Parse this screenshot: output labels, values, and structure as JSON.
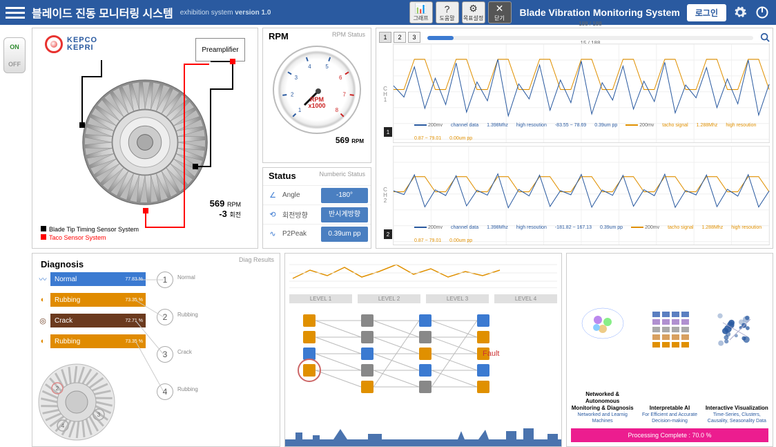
{
  "header": {
    "app_title_kr": "블레이드 진동 모니터링 시스템",
    "sub_label": "exhibition system",
    "version_label": "version 1.0",
    "app_title_en": "Blade Vibration Monitoring System",
    "login_btn": "로그인",
    "icon_btns": [
      {
        "name": "chart-icon",
        "label": "그래프"
      },
      {
        "name": "question-icon",
        "label": "도움말"
      },
      {
        "name": "gear-icon",
        "label": "목표설정"
      },
      {
        "name": "close-icon",
        "label": "닫기"
      }
    ]
  },
  "toggle": {
    "on": "ON",
    "off": "OFF"
  },
  "turbine": {
    "logo1": "KEPCO",
    "logo2": "KEPRI",
    "preamp": "Preamplifier",
    "rpm": "569",
    "rpm_unit": "RPM",
    "rot": "-3",
    "rot_unit": "회전",
    "legend_black": "Blade Tip Timing Sensor System",
    "legend_red": "Taco Sensor System"
  },
  "rpm_panel": {
    "title": "RPM",
    "sub": "RPM Status",
    "gauge_label": "RPM\nx1000",
    "ticks": [
      "1",
      "2",
      "3",
      "4",
      "5",
      "6",
      "7",
      "8"
    ],
    "value": "569",
    "unit": "RPM"
  },
  "status_panel": {
    "title": "Status",
    "sub": "Numberic Status",
    "rows": [
      {
        "icon": "angle-icon",
        "label": "Angle",
        "value": "-180°"
      },
      {
        "icon": "rotation-icon",
        "label": "회전방향",
        "value": "반시계방향"
      },
      {
        "icon": "peak-icon",
        "label": "P2Peak",
        "value": "0.39um pp"
      }
    ]
  },
  "charts": {
    "pages": [
      "1",
      "2",
      "3"
    ],
    "progress_top": "188 / 188",
    "progress_bottom": "15 / 188",
    "progress_pct": 8,
    "ch": [
      {
        "label": "CH1",
        "tag": "1",
        "legend": [
          {
            "color": "#2a5aa0",
            "vol": "200mv",
            "src": "channel data",
            "freq": "1.398Mhz",
            "res": "high resoution",
            "a": "-83.55",
            "b": "78.69",
            "c": "0.39um pp"
          },
          {
            "color": "#e09000",
            "vol": "200mv",
            "src": "tacho signal",
            "freq": "1.288Mhz",
            "res": "high resoution",
            "a": "0.87",
            "b": "79.01",
            "c": "0.00um pp"
          }
        ]
      },
      {
        "label": "CH2",
        "tag": "2",
        "legend": [
          {
            "color": "#2a5aa0",
            "vol": "200mv",
            "src": "channel data",
            "freq": "1.398Mhz",
            "res": "high resoution",
            "a": "-181.82",
            "b": "167.13",
            "c": "0.39um pp"
          },
          {
            "color": "#e09000",
            "vol": "200mv",
            "src": "tacho signal",
            "freq": "1.288Mhz",
            "res": "high resoution",
            "a": "0.87",
            "b": "79.01",
            "c": "0.00um pp"
          }
        ]
      }
    ]
  },
  "diagnosis": {
    "title": "Diagnosis",
    "sub": "Diag Results",
    "items": [
      {
        "label": "Normal",
        "color": "#3b7ad1",
        "pct": "77.83 %"
      },
      {
        "label": "Rubbing",
        "color": "#e08b00",
        "pct": "73.35 %"
      },
      {
        "label": "Crack",
        "color": "#6b3a1e",
        "pct": "72.71 %"
      },
      {
        "label": "Rubbing",
        "color": "#e08b00",
        "pct": "73.35 %"
      }
    ],
    "nums": [
      {
        "n": "1",
        "lbl": "Normal"
      },
      {
        "n": "2",
        "lbl": "Rubbing"
      },
      {
        "n": "3",
        "lbl": "Crack"
      },
      {
        "n": "4",
        "lbl": "Rubbing"
      }
    ]
  },
  "flow": {
    "levels": [
      "LEVEL 1",
      "LEVEL 2",
      "LEVEL 3",
      "LEVEL 4"
    ],
    "fault": "Fault"
  },
  "info": {
    "cols": [
      {
        "title": "Networked & Autonomous Monitoring & Diagnosis",
        "sub": "Networked and Learnig Machines"
      },
      {
        "title": "Interpretable  AI",
        "sub": "For Efficient and Accurate Decision-making"
      },
      {
        "title": "Interactive Visualization",
        "sub": "Time-Series, Clusters, Causality, Seasonality Data"
      }
    ],
    "processing": "Processing Complete : 70.0 %"
  },
  "chart_data": {
    "type": "line",
    "note": "two oscilloscope-style channels; values approximate from pixels",
    "channels": [
      {
        "name": "CH1",
        "series": [
          {
            "name": "tacho",
            "color": "#e09000",
            "y": [
              0,
              0,
              80,
              80,
              0,
              0,
              80,
              80,
              0,
              0,
              80,
              80,
              0,
              0,
              80,
              80,
              0,
              0,
              80,
              80,
              0,
              0,
              80,
              80,
              0,
              0,
              80,
              80,
              0,
              0,
              80,
              80,
              0,
              0,
              80,
              80,
              0
            ]
          },
          {
            "name": "channel",
            "color": "#2a5aa0",
            "y": [
              10,
              -20,
              60,
              -50,
              30,
              -40,
              70,
              -60,
              20,
              -30,
              80,
              -70,
              15,
              -25,
              65,
              -55,
              25,
              -35,
              75,
              -65,
              18,
              -28,
              62,
              -52,
              22,
              -32,
              72,
              -62,
              12,
              -22,
              58,
              -48,
              28,
              -38,
              78,
              -68,
              14
            ]
          }
        ],
        "ylim": [
          -100,
          100
        ]
      },
      {
        "name": "CH2",
        "series": [
          {
            "name": "tacho",
            "color": "#e09000",
            "y": [
              0,
              0,
              80,
              80,
              0,
              0,
              80,
              80,
              0,
              0,
              80,
              80,
              0,
              0,
              80,
              80,
              0,
              0,
              80,
              80,
              0,
              0,
              80,
              80,
              0,
              0,
              80,
              80,
              0,
              0,
              80,
              80,
              0,
              0,
              80,
              80,
              0
            ]
          },
          {
            "name": "channel",
            "color": "#2a5aa0",
            "y": [
              5,
              -15,
              90,
              -80,
              10,
              -20,
              85,
              -75,
              8,
              -18,
              95,
              -85,
              12,
              -22,
              88,
              -78,
              6,
              -16,
              92,
              -82,
              9,
              -19,
              87,
              -77,
              11,
              -21,
              93,
              -83,
              7,
              -17,
              89,
              -79,
              13,
              -23,
              91,
              -81,
              4
            ]
          }
        ],
        "ylim": [
          -200,
          200
        ]
      }
    ]
  }
}
